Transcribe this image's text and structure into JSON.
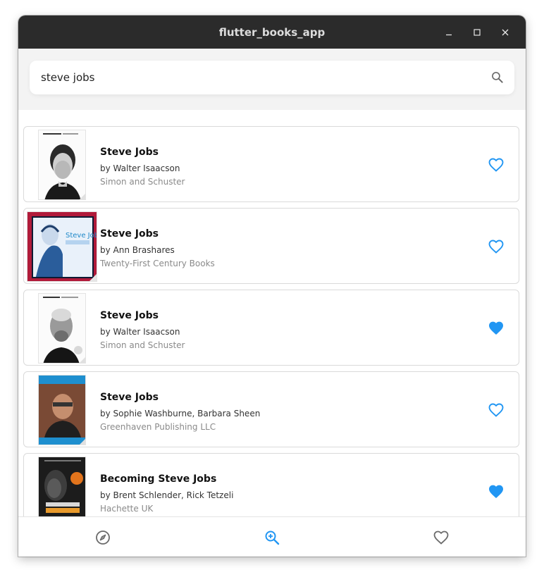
{
  "window": {
    "title": "flutter_books_app"
  },
  "search": {
    "value": "steve jobs",
    "placeholder": ""
  },
  "colors": {
    "accent": "#2196F3",
    "icon_gray": "#6a6a6a",
    "titlebar": "#2b2b2b"
  },
  "books": [
    {
      "title": "Steve Jobs",
      "author": "by Walter Isaacson",
      "publisher": "Simon and Schuster",
      "favorite": false,
      "cover_icon": "book-cover-portrait-bw"
    },
    {
      "title": "Steve Jobs",
      "author": "by Ann Brashares",
      "publisher": "Twenty-First Century Books",
      "favorite": false,
      "cover_icon": "book-cover-illustrated"
    },
    {
      "title": "Steve Jobs",
      "author": "by Walter Isaacson",
      "publisher": "Simon and Schuster",
      "favorite": true,
      "cover_icon": "book-cover-portrait-bw"
    },
    {
      "title": "Steve Jobs",
      "author": "by Sophie Washburne, Barbara Sheen",
      "publisher": "Greenhaven Publishing LLC",
      "favorite": false,
      "cover_icon": "book-cover-photo-blue"
    },
    {
      "title": "Becoming Steve Jobs",
      "author": "by Brent Schlender, Rick Tetzeli",
      "publisher": "Hachette UK",
      "favorite": true,
      "cover_icon": "book-cover-dark"
    }
  ],
  "bottom_nav": [
    {
      "name": "explore",
      "icon": "compass-icon",
      "active": false
    },
    {
      "name": "search",
      "icon": "zoom-in-icon",
      "active": true
    },
    {
      "name": "favorites",
      "icon": "heart-outline-icon",
      "active": false
    }
  ]
}
